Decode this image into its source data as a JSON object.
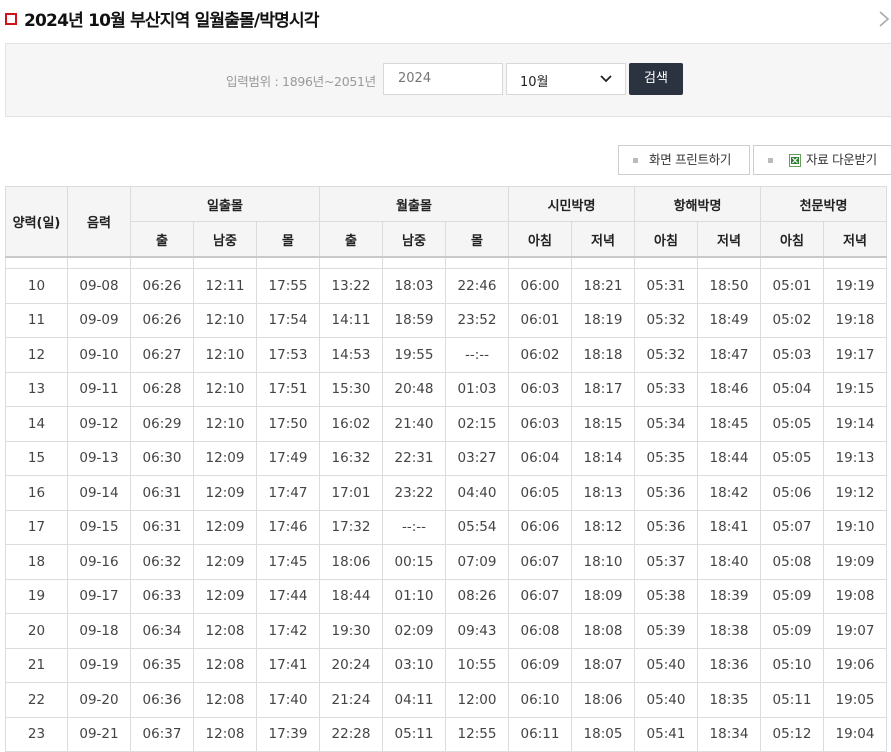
{
  "title": "2024년 10월 부산지역 일월출몰/박명시각",
  "close_glyph": "<",
  "search": {
    "range_label": "입력범위 : 1896년~2051년",
    "year_value": "2024",
    "month_value": "10월",
    "button_label": "검색"
  },
  "toolbar": {
    "print_label": "화면 프린트하기",
    "download_label": "자료 다운받기"
  },
  "table": {
    "headers": {
      "solar_day": "양력(일)",
      "lunar": "음력",
      "sun": "일출몰",
      "moon": "월출몰",
      "civil": "시민박명",
      "nautical": "항해박명",
      "astronomical": "천문박명",
      "rise": "출",
      "transit": "남중",
      "set": "몰",
      "morning": "아침",
      "evening": "저녁"
    },
    "rows": [
      [
        "10",
        "09-08",
        "06:26",
        "12:11",
        "17:55",
        "13:22",
        "18:03",
        "22:46",
        "06:00",
        "18:21",
        "05:31",
        "18:50",
        "05:01",
        "19:19"
      ],
      [
        "11",
        "09-09",
        "06:26",
        "12:10",
        "17:54",
        "14:11",
        "18:59",
        "23:52",
        "06:01",
        "18:19",
        "05:32",
        "18:49",
        "05:02",
        "19:18"
      ],
      [
        "12",
        "09-10",
        "06:27",
        "12:10",
        "17:53",
        "14:53",
        "19:55",
        "--:--",
        "06:02",
        "18:18",
        "05:32",
        "18:47",
        "05:03",
        "19:17"
      ],
      [
        "13",
        "09-11",
        "06:28",
        "12:10",
        "17:51",
        "15:30",
        "20:48",
        "01:03",
        "06:03",
        "18:17",
        "05:33",
        "18:46",
        "05:04",
        "19:15"
      ],
      [
        "14",
        "09-12",
        "06:29",
        "12:10",
        "17:50",
        "16:02",
        "21:40",
        "02:15",
        "06:03",
        "18:15",
        "05:34",
        "18:45",
        "05:05",
        "19:14"
      ],
      [
        "15",
        "09-13",
        "06:30",
        "12:09",
        "17:49",
        "16:32",
        "22:31",
        "03:27",
        "06:04",
        "18:14",
        "05:35",
        "18:44",
        "05:05",
        "19:13"
      ],
      [
        "16",
        "09-14",
        "06:31",
        "12:09",
        "17:47",
        "17:01",
        "23:22",
        "04:40",
        "06:05",
        "18:13",
        "05:36",
        "18:42",
        "05:06",
        "19:12"
      ],
      [
        "17",
        "09-15",
        "06:31",
        "12:09",
        "17:46",
        "17:32",
        "--:--",
        "05:54",
        "06:06",
        "18:12",
        "05:36",
        "18:41",
        "05:07",
        "19:10"
      ],
      [
        "18",
        "09-16",
        "06:32",
        "12:09",
        "17:45",
        "18:06",
        "00:15",
        "07:09",
        "06:07",
        "18:10",
        "05:37",
        "18:40",
        "05:08",
        "19:09"
      ],
      [
        "19",
        "09-17",
        "06:33",
        "12:09",
        "17:44",
        "18:44",
        "01:10",
        "08:26",
        "06:07",
        "18:09",
        "05:38",
        "18:39",
        "05:09",
        "19:08"
      ],
      [
        "20",
        "09-18",
        "06:34",
        "12:08",
        "17:42",
        "19:30",
        "02:09",
        "09:43",
        "06:08",
        "18:08",
        "05:39",
        "18:38",
        "05:09",
        "19:07"
      ],
      [
        "21",
        "09-19",
        "06:35",
        "12:08",
        "17:41",
        "20:24",
        "03:10",
        "10:55",
        "06:09",
        "18:07",
        "05:40",
        "18:36",
        "05:10",
        "19:06"
      ],
      [
        "22",
        "09-20",
        "06:36",
        "12:08",
        "17:40",
        "21:24",
        "04:11",
        "12:00",
        "06:10",
        "18:06",
        "05:40",
        "18:35",
        "05:11",
        "19:05"
      ],
      [
        "23",
        "09-21",
        "06:37",
        "12:08",
        "17:39",
        "22:28",
        "05:11",
        "12:55",
        "06:11",
        "18:05",
        "05:41",
        "18:34",
        "05:12",
        "19:04"
      ]
    ]
  }
}
